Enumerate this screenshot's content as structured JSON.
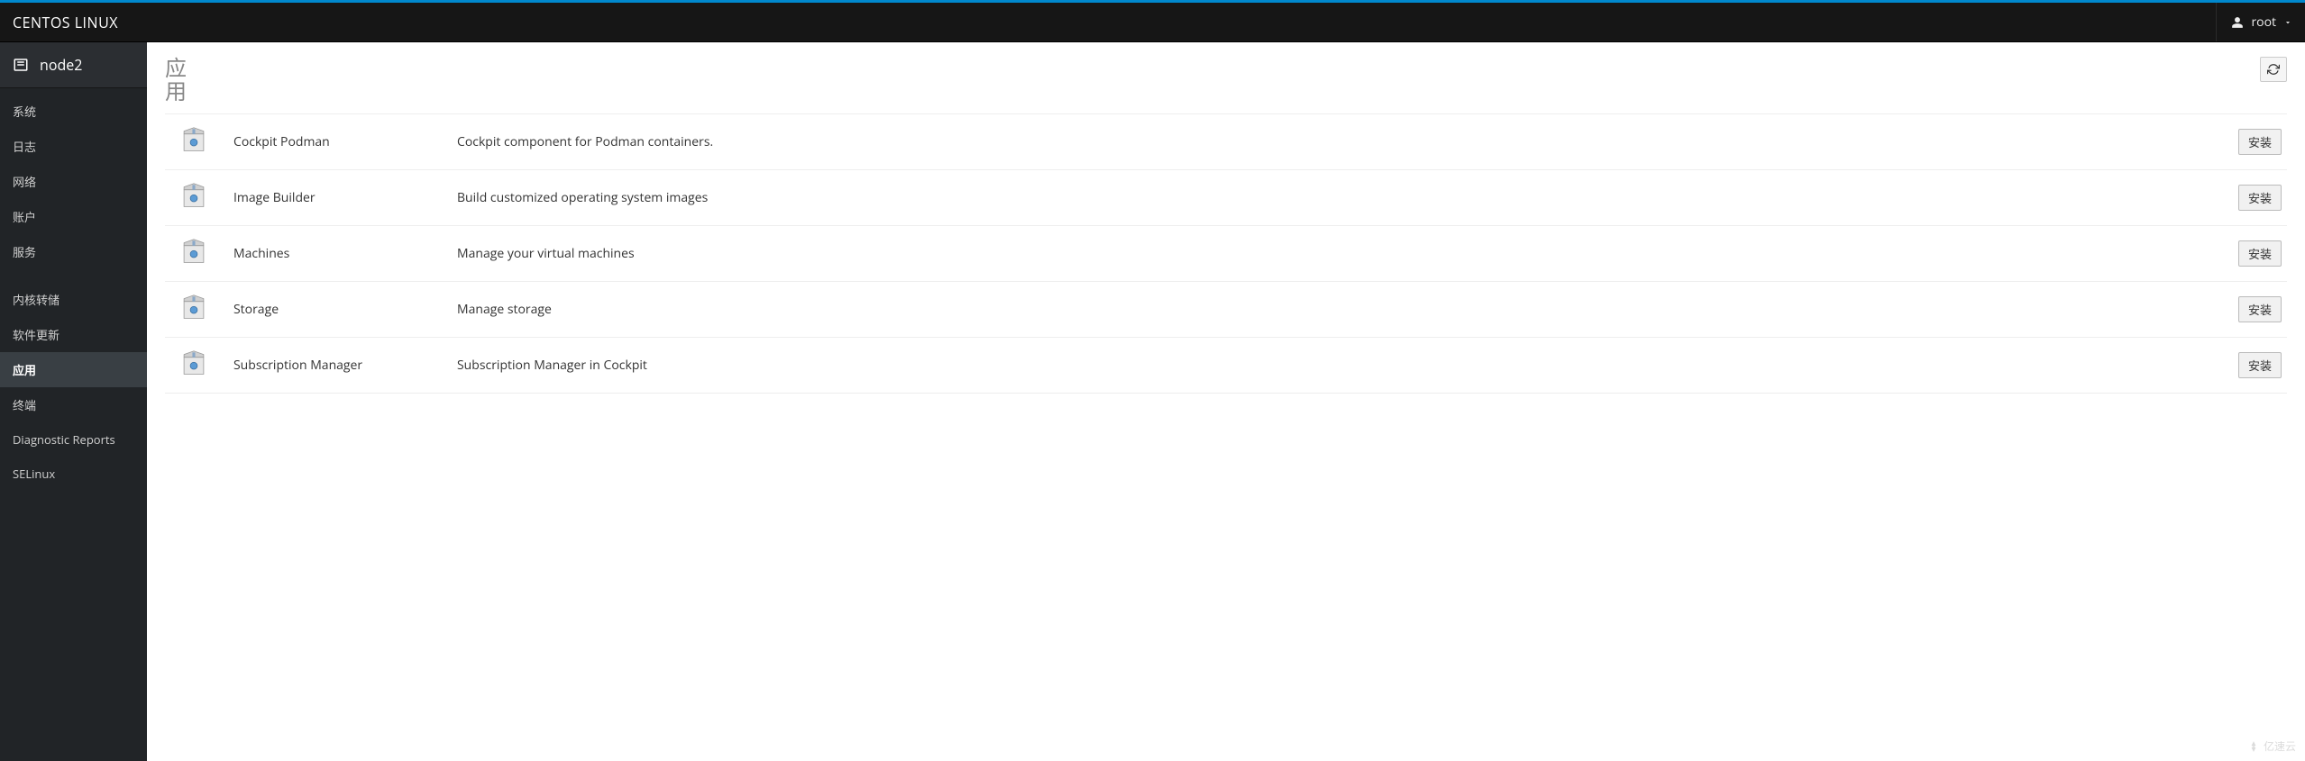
{
  "header": {
    "brand": "CENTOS LINUX",
    "user": "root"
  },
  "sidebar": {
    "host": "node2",
    "items": [
      {
        "label": "系统",
        "active": false
      },
      {
        "label": "日志",
        "active": false
      },
      {
        "label": "网络",
        "active": false
      },
      {
        "label": "账户",
        "active": false
      },
      {
        "label": "服务",
        "active": false
      },
      {
        "spacer": true
      },
      {
        "label": "内核转储",
        "active": false
      },
      {
        "label": "软件更新",
        "active": false
      },
      {
        "label": "应用",
        "active": true
      },
      {
        "label": "终端",
        "active": false
      },
      {
        "label": "Diagnostic Reports",
        "active": false
      },
      {
        "label": "SELinux",
        "active": false
      }
    ]
  },
  "main": {
    "title": "应用",
    "install_label": "安装",
    "apps": [
      {
        "name": "Cockpit Podman",
        "desc": "Cockpit component for Podman containers."
      },
      {
        "name": "Image Builder",
        "desc": "Build customized operating system images"
      },
      {
        "name": "Machines",
        "desc": "Manage your virtual machines"
      },
      {
        "name": "Storage",
        "desc": "Manage storage"
      },
      {
        "name": "Subscription Manager",
        "desc": "Subscription Manager in Cockpit"
      }
    ]
  },
  "watermark": "亿速云"
}
